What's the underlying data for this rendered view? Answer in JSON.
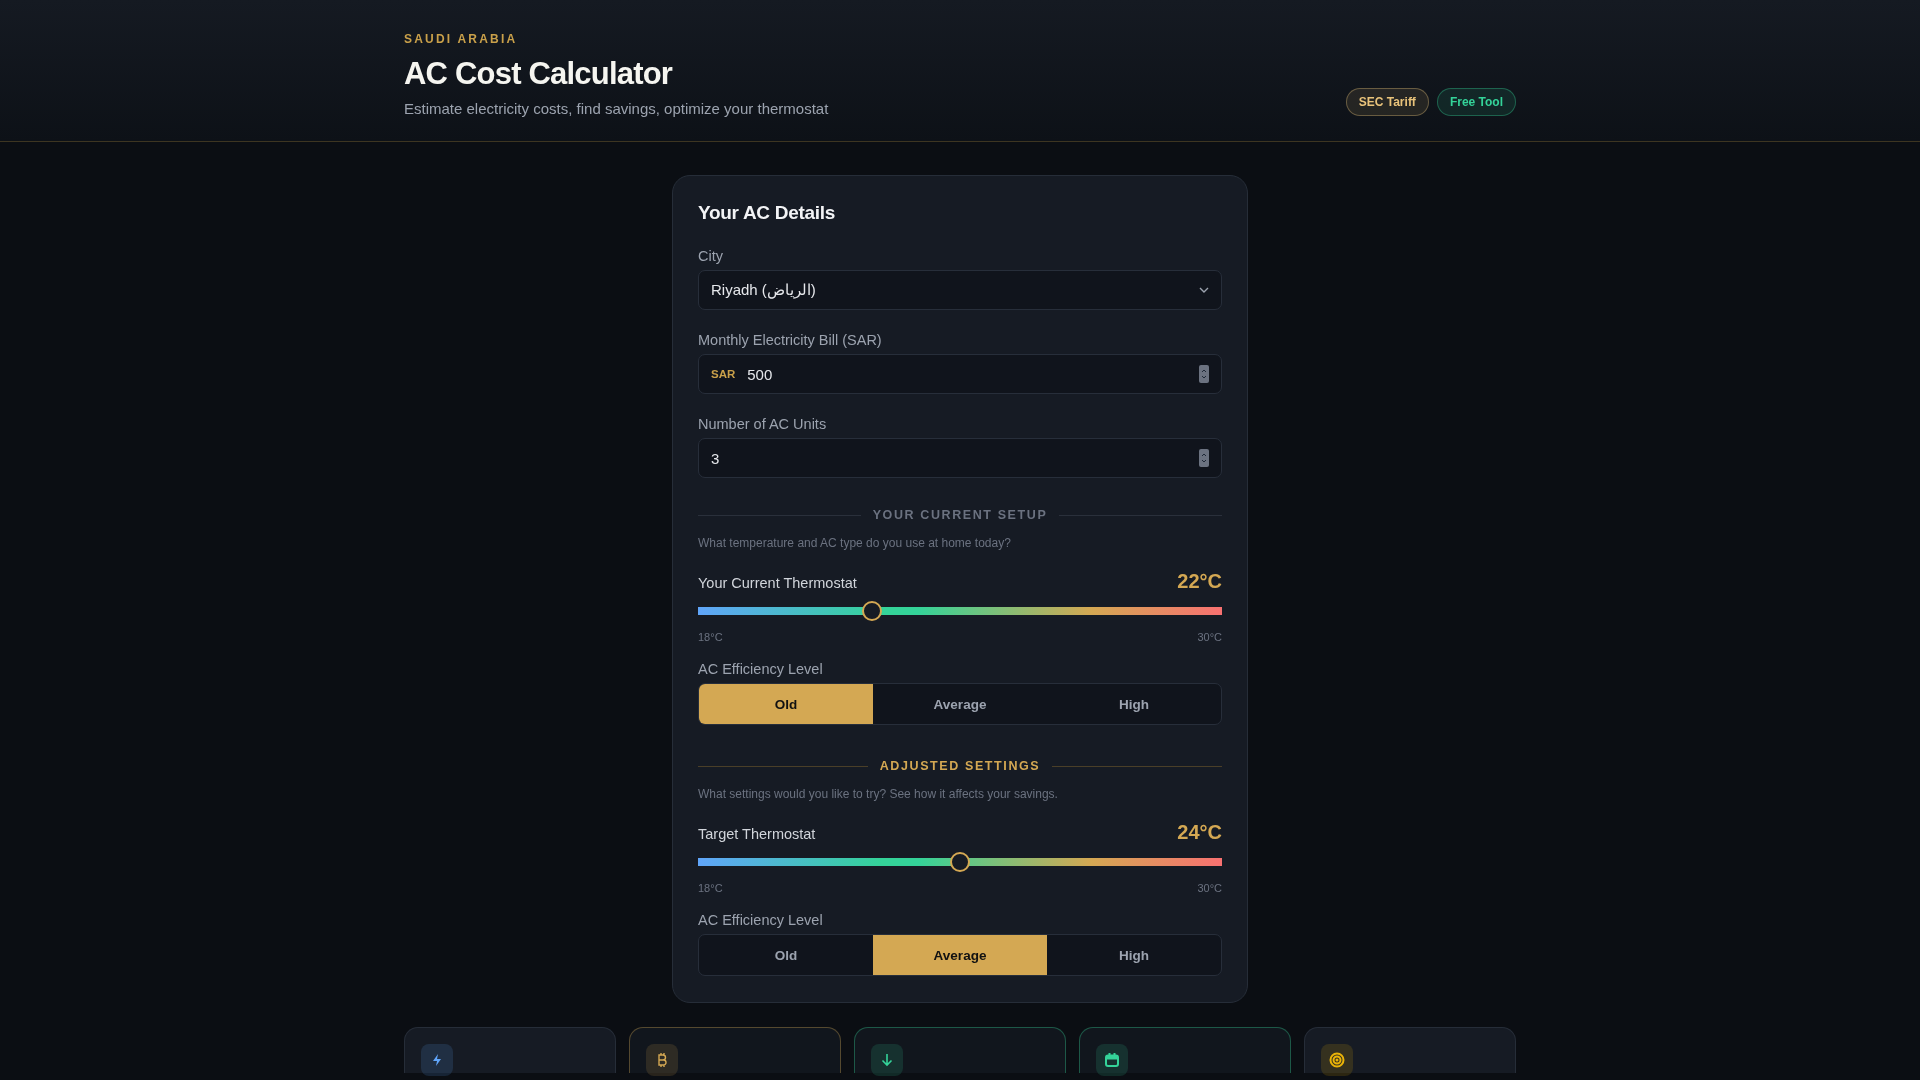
{
  "header": {
    "eyebrow": "SAUDI ARABIA",
    "title": "AC Cost Calculator",
    "subtitle": "Estimate electricity costs, find savings, optimize your thermostat",
    "badges": [
      {
        "label": "SEC Tariff",
        "color": "#e8c27a"
      },
      {
        "label": "Free Tool",
        "color": "#34d399"
      }
    ]
  },
  "form": {
    "title": "Your AC Details",
    "fields": [
      {
        "kind": "select",
        "label": "City",
        "value": "Riyadh (الرياض)"
      },
      {
        "kind": "number",
        "label": "Monthly Electricity Bill (SAR)",
        "prefix": "SAR",
        "value": "500"
      },
      {
        "kind": "number",
        "label": "Number of AC Units",
        "value": "3"
      }
    ],
    "sections": [
      {
        "kind": "current",
        "heading": "YOUR CURRENT SETUP",
        "hint": "What temperature and AC type do you use at home today?",
        "slider": {
          "label": "Your Current Thermostat",
          "reading": "22°C",
          "level": 0.333,
          "min_label": "18°C",
          "max_label": "30°C"
        },
        "efficiency": {
          "label": "AC Efficiency Level",
          "options": [
            {
              "label": "Old",
              "selected": true
            },
            {
              "label": "Average",
              "selected": false
            },
            {
              "label": "High",
              "selected": false
            }
          ]
        }
      },
      {
        "kind": "adjusted",
        "heading": "ADJUSTED SETTINGS",
        "hint": "What settings would you like to try? See how it affects your savings.",
        "slider": {
          "label": "Target Thermostat",
          "reading": "24°C",
          "level": 0.5,
          "min_label": "18°C",
          "max_label": "30°C"
        },
        "efficiency": {
          "label": "AC Efficiency Level",
          "options": [
            {
              "label": "Old",
              "selected": false
            },
            {
              "label": "Average",
              "selected": true
            },
            {
              "label": "High",
              "selected": false
            }
          ]
        }
      }
    ]
  },
  "stat_cards": [
    {
      "kind": "bolt",
      "color": "#60a5fa",
      "highlighted": false
    },
    {
      "kind": "currency",
      "color": "#d4a853",
      "highlighted": true
    },
    {
      "kind": "arrow",
      "color": "#34d399",
      "highlighted": true
    },
    {
      "kind": "calendar",
      "color": "#34d399",
      "highlighted": true
    },
    {
      "kind": "target",
      "color": "#eab308",
      "highlighted": false
    }
  ]
}
